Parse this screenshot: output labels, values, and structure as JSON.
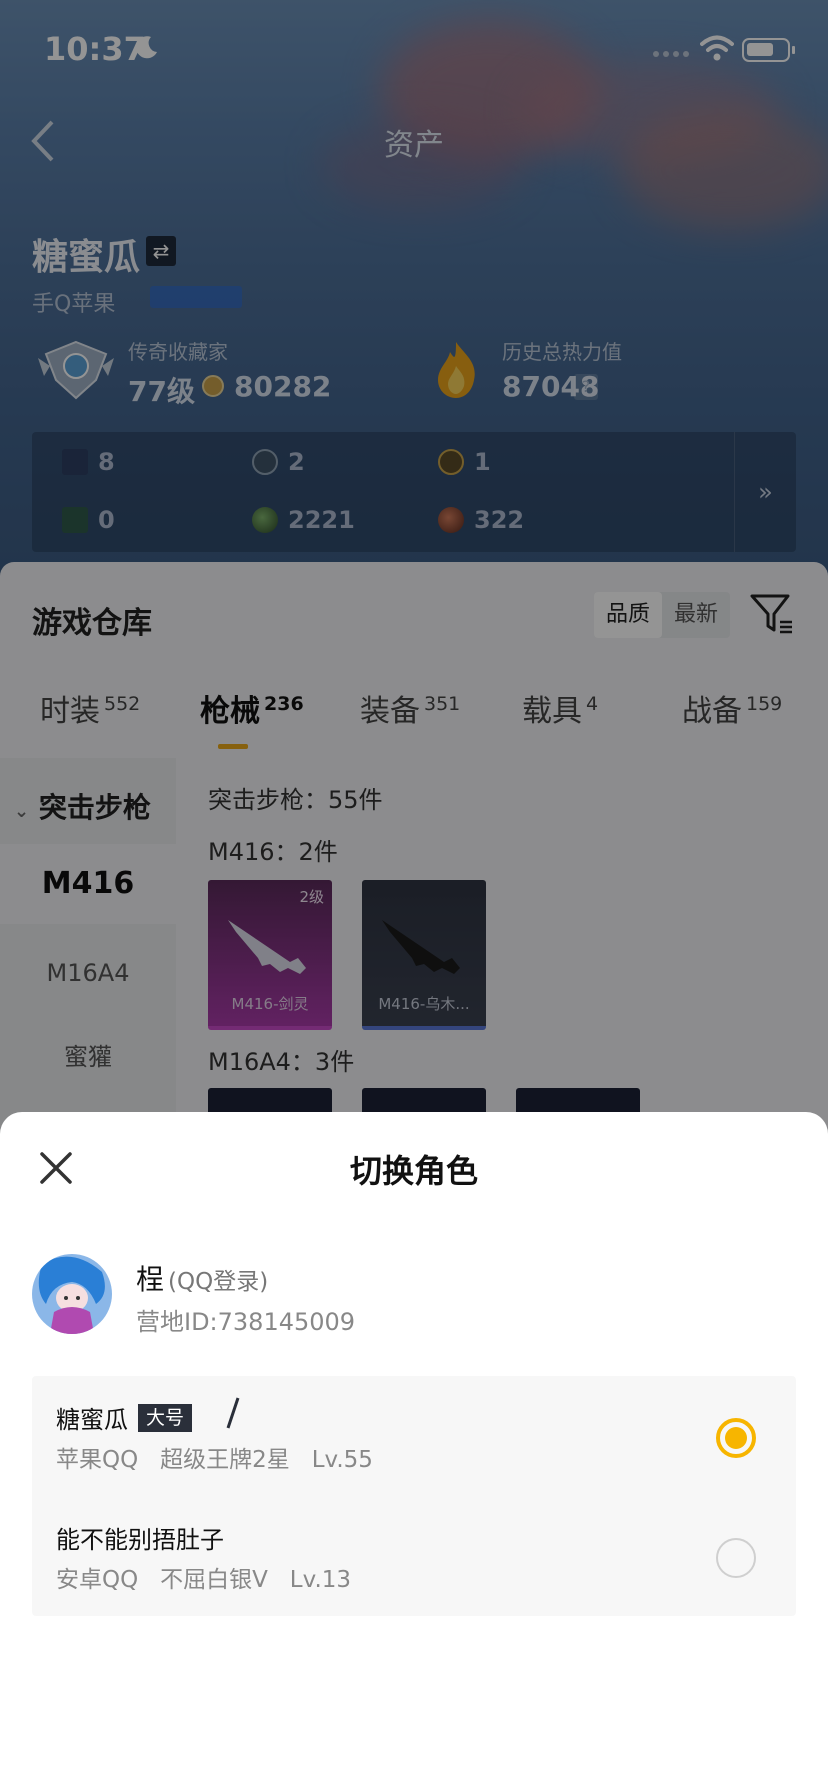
{
  "status_bar": {
    "time": "10:37"
  },
  "nav": {
    "title": "资产"
  },
  "profile": {
    "name": "糖蜜瓜",
    "platform": "手Q苹果",
    "collector_title": "传奇收藏家",
    "level": "77级",
    "coins": "80282",
    "heat_title": "历史总热力值",
    "heat_value": "87048",
    "help": "?"
  },
  "stats": [
    {
      "icon": "card-icon",
      "value": "8"
    },
    {
      "icon": "emblem-icon",
      "value": "2"
    },
    {
      "icon": "medal-icon",
      "value": "1"
    },
    {
      "icon": "gem-icon",
      "value": "0"
    },
    {
      "icon": "orb-icon",
      "value": "2221"
    },
    {
      "icon": "crate-icon",
      "value": "322"
    }
  ],
  "warehouse": {
    "title": "游戏仓库",
    "sort_quality": "品质",
    "sort_newest": "最新",
    "tabs": [
      {
        "label": "时装",
        "count": "552"
      },
      {
        "label": "枪械",
        "count": "236"
      },
      {
        "label": "装备",
        "count": "351"
      },
      {
        "label": "载具",
        "count": "4"
      },
      {
        "label": "战备",
        "count": "159"
      }
    ],
    "side_group": "突击步枪",
    "side_items": [
      "M416",
      "M16A4",
      "蜜獾"
    ],
    "summary": "突击步枪：55件",
    "m416_header": "M416：2件",
    "m416_items": [
      {
        "name": "M416-剑灵",
        "level": "2级"
      },
      {
        "name": "M416-乌木...",
        "level": ""
      }
    ],
    "m16a4_header": "M16A4：3件"
  },
  "sheet": {
    "title": "切换角色",
    "user": {
      "name": "桯",
      "login": "(QQ登录)",
      "id": "营地ID:738145009"
    },
    "roles": [
      {
        "name": "糖蜜瓜",
        "tag": "大号",
        "detail": "苹果QQ   超级王牌2星   Lv.55",
        "selected": true
      },
      {
        "name": "能不能别捂肚子",
        "tag": "",
        "detail": "安卓QQ   不屈白银V   Lv.13",
        "selected": false
      }
    ]
  },
  "colors": {
    "accent": "#f7b500",
    "tab_indicator": "#e8a81a"
  }
}
